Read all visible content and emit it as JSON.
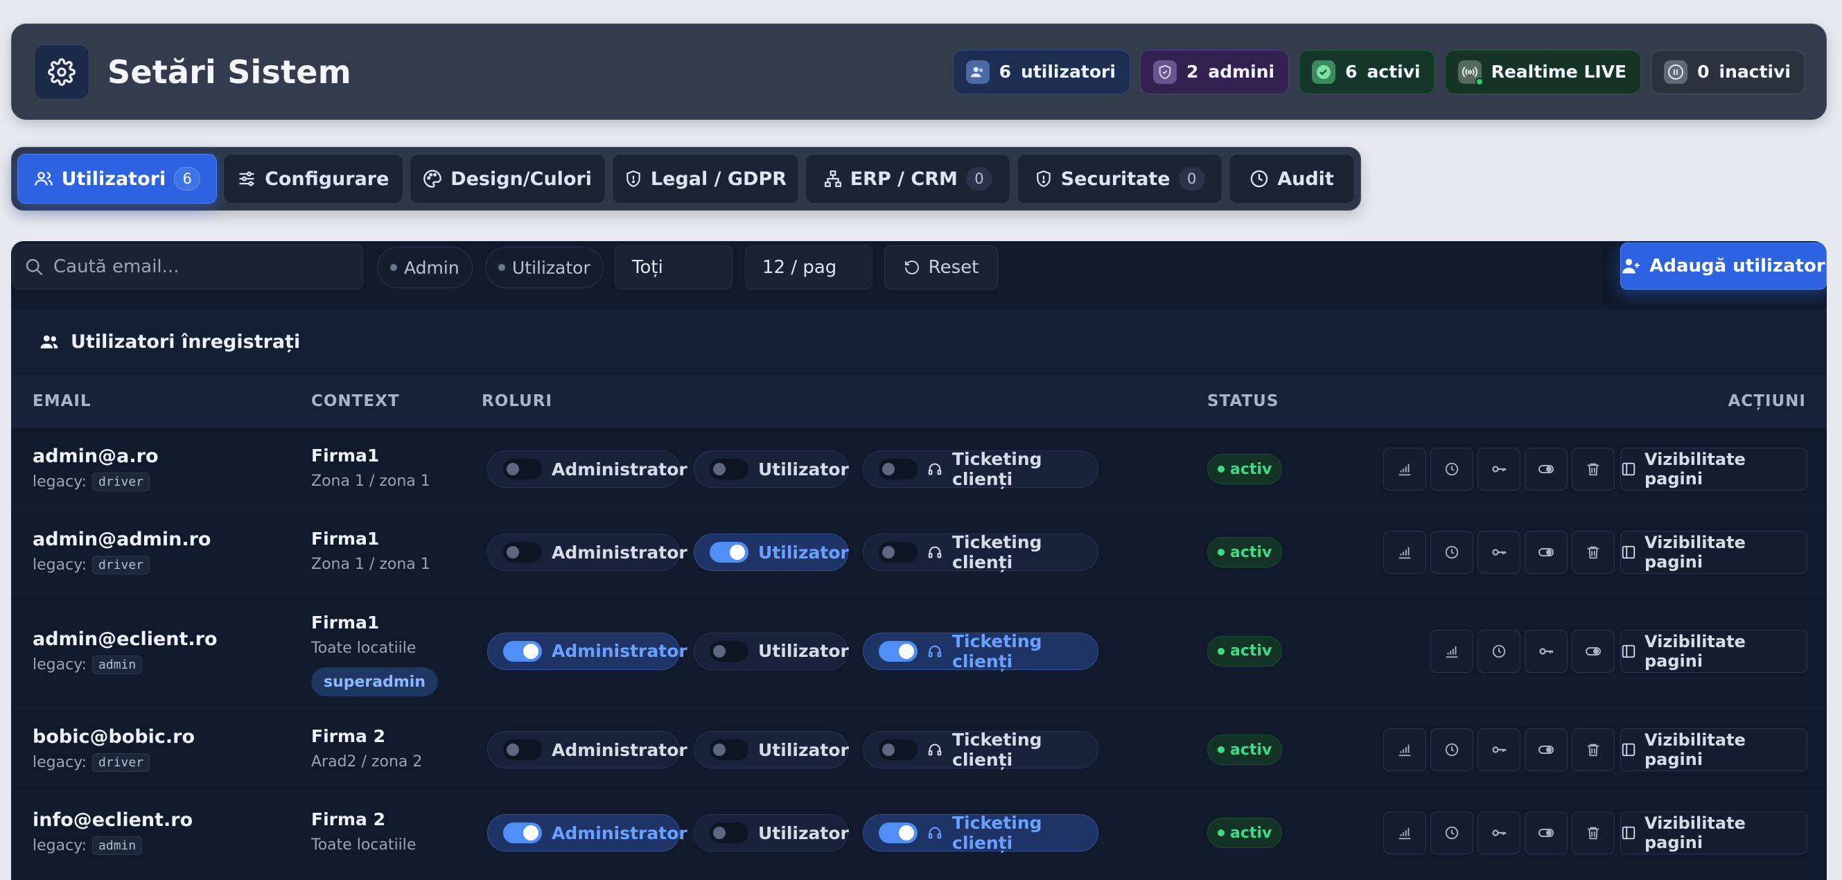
{
  "header": {
    "title": "Setări Sistem",
    "chips": {
      "users": {
        "count": "6",
        "label": "utilizatori"
      },
      "admins": {
        "count": "2",
        "label": "admini"
      },
      "active": {
        "count": "6",
        "label": "activi"
      },
      "live": {
        "label": "Realtime LIVE"
      },
      "inactive": {
        "count": "0",
        "label": "inactivi"
      }
    }
  },
  "tabs": [
    {
      "label": "Utilizatori",
      "count": "6",
      "icon": "users-icon"
    },
    {
      "label": "Configurare",
      "icon": "sliders-icon"
    },
    {
      "label": "Design/Culori",
      "icon": "palette-icon"
    },
    {
      "label": "Legal / GDPR",
      "icon": "shield-icon"
    },
    {
      "label": "ERP / CRM",
      "count": "0",
      "icon": "network-icon"
    },
    {
      "label": "Securitate",
      "count": "0",
      "icon": "shield-icon"
    },
    {
      "label": "Audit",
      "icon": "clock-icon"
    }
  ],
  "toolbar": {
    "search_placeholder": "Caută email...",
    "filter_admin": "Admin",
    "filter_user": "Utilizator",
    "status_select": "Toți",
    "page_size": "12 / pag",
    "reset": "Reset",
    "add_user": "Adaugă utilizator"
  },
  "table": {
    "heading": "Utilizatori înregistrați",
    "columns": {
      "email": "EMAIL",
      "context": "CONTEXT",
      "roles": "ROLURI",
      "status": "STATUS",
      "actions": "ACȚIUNI"
    },
    "legacy_label": "legacy:",
    "role_labels": {
      "admin": "Administrator",
      "user": "Utilizator",
      "ticketing": "Ticketing clienți"
    },
    "visibility_label": "Vizibilitate pagini",
    "rows": [
      {
        "email": "admin@a.ro",
        "legacy": "driver",
        "firm": "Firma1",
        "zone": "Zona 1 / zona 1",
        "status": "activ",
        "admin": false,
        "user": false,
        "ticketing": false
      },
      {
        "email": "admin@admin.ro",
        "legacy": "driver",
        "firm": "Firma1",
        "zone": "Zona 1 / zona 1",
        "status": "activ",
        "admin": false,
        "user": true,
        "ticketing": false
      },
      {
        "email": "admin@eclient.ro",
        "legacy": "admin",
        "firm": "Firma1",
        "zone": "Toate locatiile",
        "badge": "superadmin",
        "status": "activ",
        "admin": true,
        "user": false,
        "ticketing": true
      },
      {
        "email": "bobic@bobic.ro",
        "legacy": "driver",
        "firm": "Firma 2",
        "zone": "Arad2 / zona 2",
        "status": "activ",
        "admin": false,
        "user": false,
        "ticketing": false
      },
      {
        "email": "info@eclient.ro",
        "legacy": "admin",
        "firm": "Firma 2",
        "zone": "Toate locatiile",
        "status": "activ",
        "admin": true,
        "user": false,
        "ticketing": true
      }
    ]
  },
  "colors": {
    "accent": "#2d63e0",
    "success": "#3ddc84",
    "panel": "#111a2c"
  }
}
